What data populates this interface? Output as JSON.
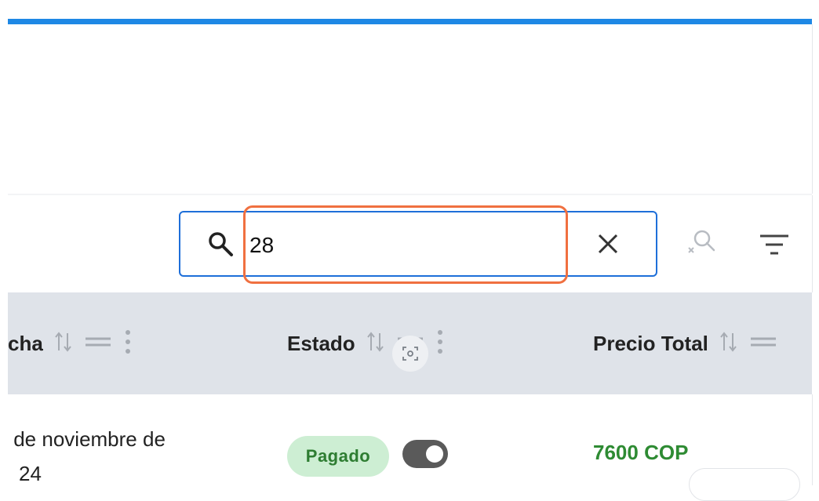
{
  "search": {
    "value": "28",
    "placeholder": ""
  },
  "icons": {
    "search": "search-icon",
    "clear": "close-icon",
    "clear_filters": "clear-filter-icon",
    "filter": "filter-icon",
    "sort": "sort-icon",
    "reorder": "drag-handle-icon",
    "column_menu": "vertical-dots-icon",
    "capture": "screen-capture-icon"
  },
  "table": {
    "columns": [
      {
        "label": "cha"
      },
      {
        "label": "Estado"
      },
      {
        "label": "Precio Total"
      }
    ],
    "rows": [
      {
        "fecha_line1": " de noviembre de",
        "fecha_line2": "24",
        "estado": "Pagado",
        "toggle_on": true,
        "precio": "7600 COP"
      }
    ]
  },
  "colors": {
    "accent": "#1e88e5",
    "search_border": "#1e6fd9",
    "highlight": "#f07040",
    "header_bg": "#dfe3e9",
    "paid_badge_bg": "#cdeed3",
    "paid_badge_text": "#2e7d32",
    "price_text": "#2e8b33"
  }
}
